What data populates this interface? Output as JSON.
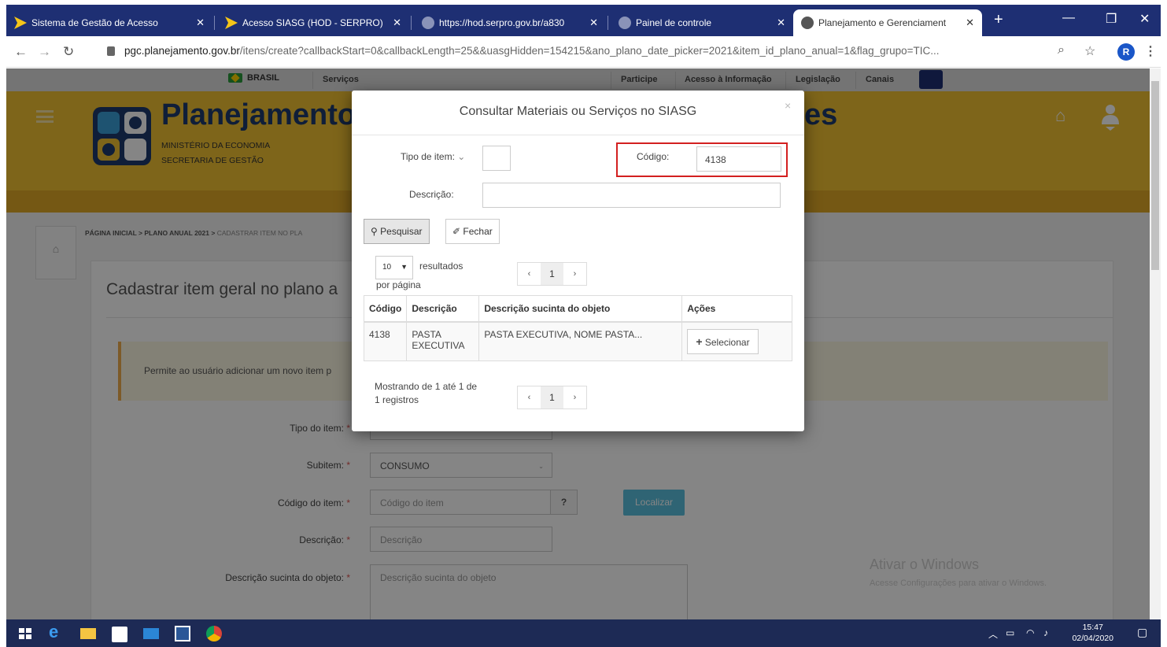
{
  "browser": {
    "tabs": [
      {
        "title": "Sistema de Gestão de Acesso",
        "active": false
      },
      {
        "title": "Acesso SIASG (HOD - SERPRO)",
        "active": false
      },
      {
        "title": "https://hod.serpro.gov.br/a830",
        "active": false
      },
      {
        "title": "Painel de controle",
        "active": false
      },
      {
        "title": "Planejamento e Gerenciament",
        "active": true
      }
    ],
    "new_tab": "+",
    "url_host": "pgc.planejamento.gov.br",
    "url_path": "/itens/create?callbackStart=0&callbackLength=25&&uasgHidden=154215&ano_plano_date_picker=2021&item_id_plano_anual=1&flag_grupo=TIC...",
    "profile_initial": "R"
  },
  "govbar": {
    "brasil": "BRASIL",
    "servicos": "Serviços",
    "links": [
      "Participe",
      "Acesso à Informação",
      "Legislação",
      "Canais"
    ]
  },
  "header": {
    "title": "Planejamento",
    "title_tail": "es",
    "subtitle1": "MINISTÉRIO DA ECONOMIA",
    "subtitle2": "SECRETARIA DE GESTÃO"
  },
  "breadcrumb": {
    "path": "PÁGINA INICIAL > PLANO ANUAL 2021 > ",
    "current": "CADASTRAR ITEM NO PLA"
  },
  "page": {
    "heading": "Cadastrar item geral no plano a",
    "alert": "Permite ao usuário adicionar um novo item p"
  },
  "form": {
    "tipo_item_label": "Tipo do item:",
    "subitem_label": "Subitem:",
    "subitem_value": "CONSUMO",
    "codigo_label": "Código do item:",
    "codigo_placeholder": "Código do item",
    "codigo_help": "?",
    "localizar": "Localizar",
    "descricao_label": "Descrição:",
    "descricao_placeholder": "Descrição",
    "sucinta_label": "Descrição sucinta do objeto:",
    "sucinta_placeholder": "Descrição sucinta do objeto",
    "required_mark": "*"
  },
  "watermark": {
    "line1": "Ativar o Windows",
    "line2": "Acesse Configurações para ativar o Windows."
  },
  "modal": {
    "title": "Consultar Materiais ou Serviços no SIASG",
    "tipo_label": "Tipo de item:",
    "tipo_caret": "⌄",
    "codigo_label": "Código:",
    "codigo_value": "4138",
    "descricao_label": "Descrição:",
    "pesquisar": "Pesquisar",
    "fechar": "Fechar",
    "per_page_value": "10",
    "resultados": "resultados",
    "por_pagina": "por página",
    "current_page": "1",
    "columns": [
      "Código",
      "Descrição",
      "Descrição sucinta do objeto",
      "Ações"
    ],
    "rows": [
      {
        "codigo": "4138",
        "descricao": "PASTA EXECUTIVA",
        "sucinta": "PASTA EXECUTIVA, NOME PASTA...",
        "acao": "Selecionar"
      }
    ],
    "mostrando_line1": "Mostrando de 1 até 1 de",
    "mostrando_line2": "1 registros"
  },
  "taskbar": {
    "time": "15:47",
    "date": "02/04/2020"
  },
  "colors": {
    "header_yellow": "#f1c232",
    "title_blue": "#1e3a6e",
    "highlight_red": "#d32020",
    "taskbar": "#1d2a55"
  }
}
